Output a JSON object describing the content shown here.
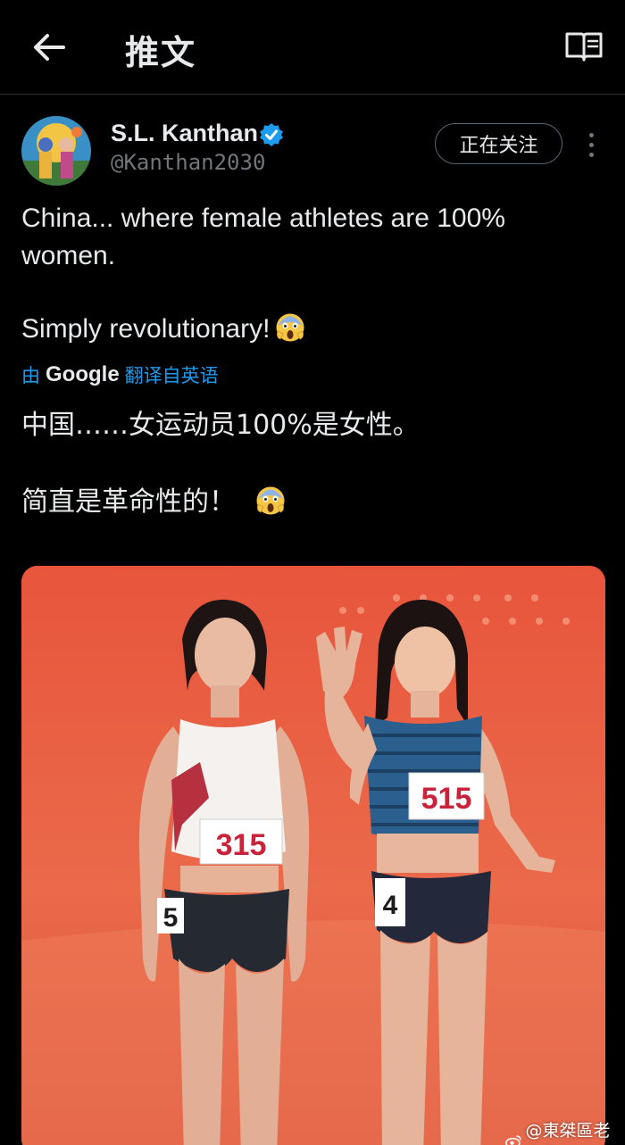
{
  "header": {
    "title": "推文"
  },
  "author": {
    "display_name": "S.L. Kanthan",
    "handle": "@Kanthan2030",
    "follow_label": "正在关注"
  },
  "tweet": {
    "line1": "China... where female athletes are 100% women.",
    "line2": "Simply revolutionary!",
    "translation_prefix": "由",
    "translation_brand": "Google",
    "translation_suffix": "翻译自英语",
    "translated_line1": "中国……女运动员100%是女性。",
    "translated_line2": "简直是革命性的！"
  },
  "media": {
    "bib_left": "315",
    "bib_right": "515",
    "side_left": "5",
    "side_right": "4"
  },
  "watermark": {
    "text": "@東桀區老白兔"
  },
  "colors": {
    "background": "#000000",
    "text": "#e7e9ea",
    "muted": "#71767b",
    "link": "#1d9bf0",
    "verified": "#1d9bf0"
  }
}
